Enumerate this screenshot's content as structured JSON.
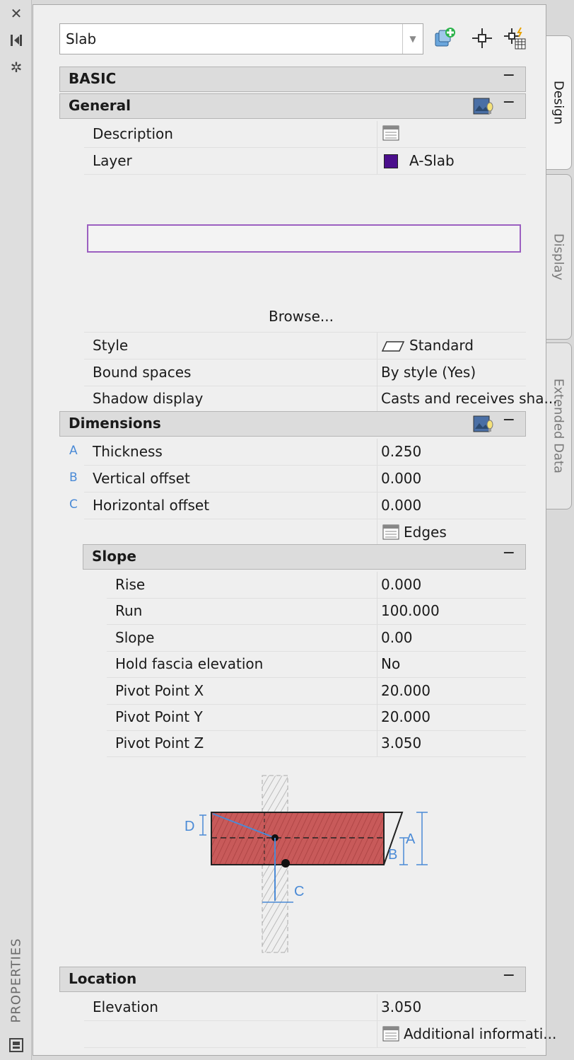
{
  "palette": {
    "title": "PROPERTIES"
  },
  "toolbar": {
    "combo_value": "Slab"
  },
  "tabs": [
    {
      "label": "Design"
    },
    {
      "label": "Display"
    },
    {
      "label": "Extended Data"
    }
  ],
  "sections": {
    "basic": {
      "label": "BASIC"
    },
    "general": {
      "label": "General",
      "description_label": "Description",
      "layer_label": "Layer",
      "layer_value": "A-Slab",
      "layer_color": "#4b0f8c",
      "browse_label": "Browse...",
      "style_label": "Style",
      "style_value": "Standard",
      "bound_label": "Bound spaces",
      "bound_value": "By style (Yes)",
      "shadow_label": "Shadow display",
      "shadow_value": "Casts and receives sha..."
    },
    "dimensions": {
      "label": "Dimensions",
      "thickness_letter": "A",
      "thickness_label": "Thickness",
      "thickness_value": "0.250",
      "vertical_letter": "B",
      "vertical_label": "Vertical offset",
      "vertical_value": "0.000",
      "horizontal_letter": "C",
      "horizontal_label": "Horizontal offset",
      "horizontal_value": "0.000",
      "edges_label": "Edges"
    },
    "slope": {
      "label": "Slope",
      "rows": [
        {
          "label": "Rise",
          "value": "0.000"
        },
        {
          "label": "Run",
          "value": "100.000"
        },
        {
          "label": "Slope",
          "value": "0.00"
        },
        {
          "label": "Hold fascia elevation",
          "value": "No"
        },
        {
          "label": "Pivot Point X",
          "value": "20.000"
        },
        {
          "label": "Pivot Point Y",
          "value": "20.000"
        },
        {
          "label": "Pivot Point Z",
          "value": "3.050"
        }
      ]
    },
    "diagram": {
      "label_a": "A",
      "label_b": "B",
      "label_c": "C",
      "label_d": "D"
    },
    "location": {
      "label": "Location",
      "elevation_label": "Elevation",
      "elevation_value": "3.050",
      "additional_label": "Additional informati..."
    }
  },
  "colors": {
    "accent_letters": "#4a8ad6",
    "slab_fill": "#c85a5a",
    "edit_border": "#9b5fc0"
  }
}
